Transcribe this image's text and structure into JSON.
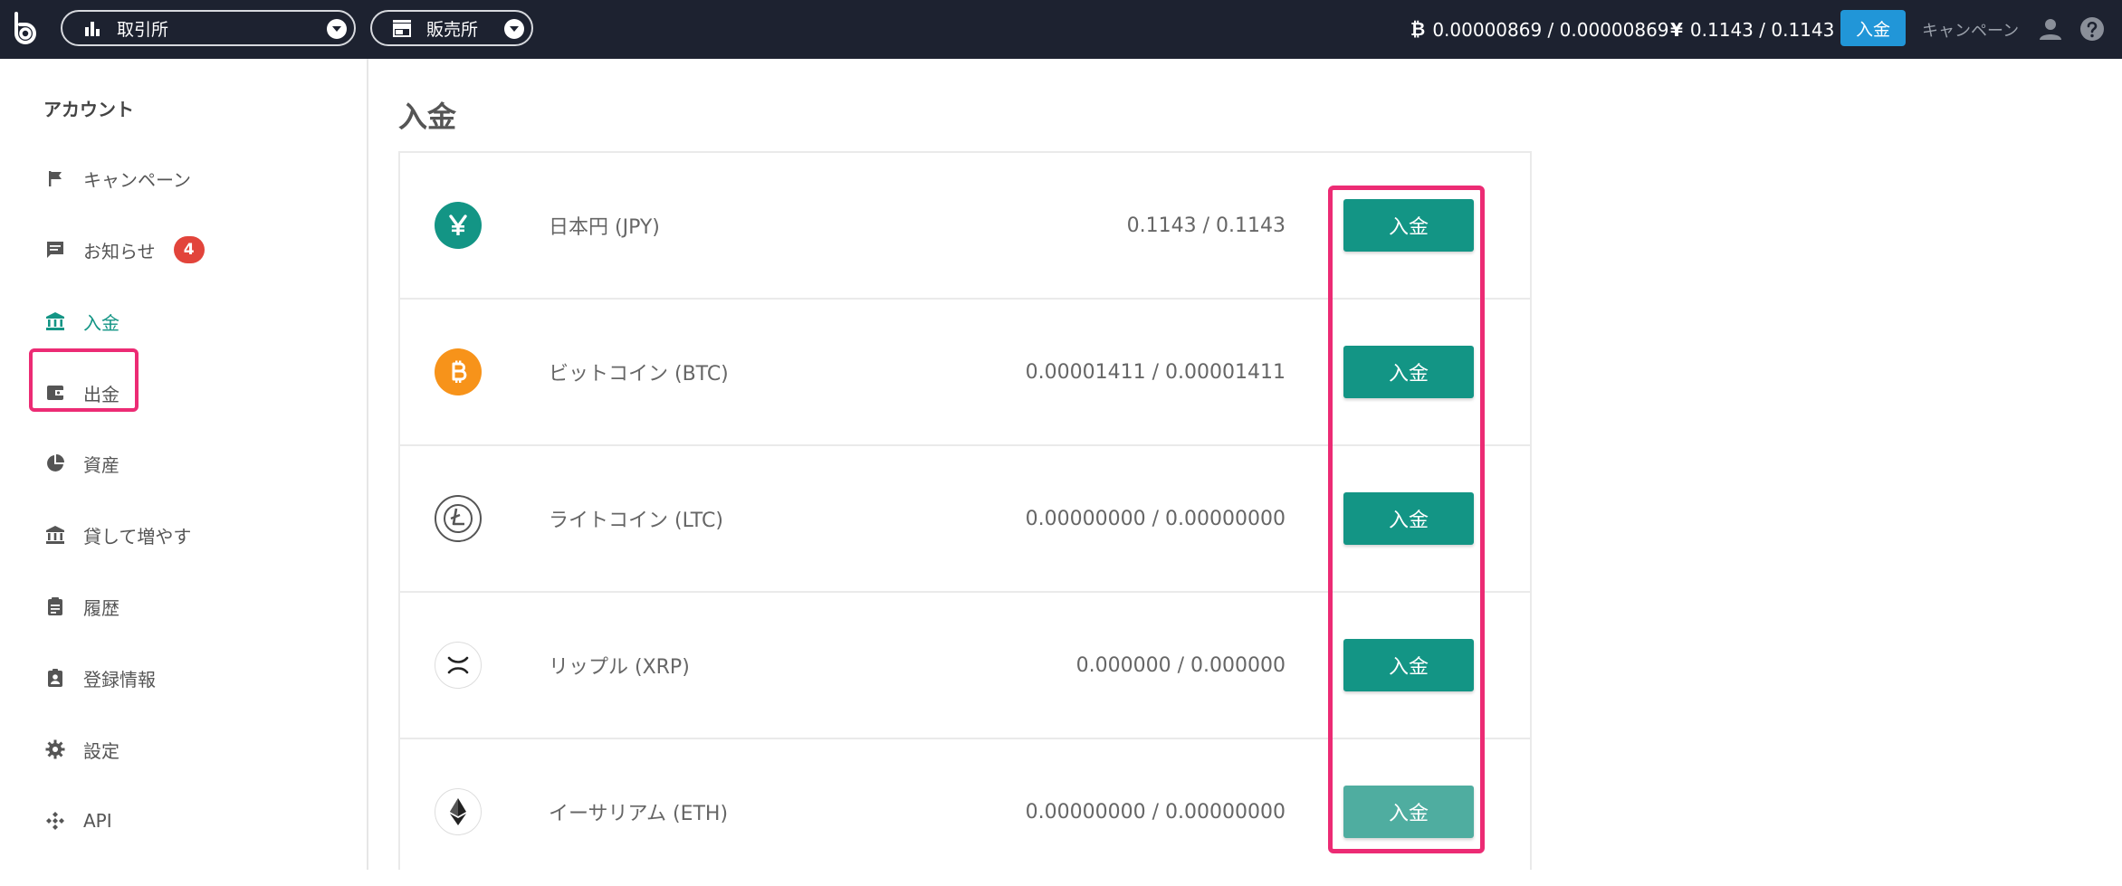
{
  "topbar": {
    "exchange_label": "取引所",
    "shop_label": "販売所",
    "btc_symbol": "₿",
    "btc_balance": "0.00000869 / 0.00000869",
    "jpy_symbol": "¥",
    "jpy_balance": "0.1143 / 0.1143",
    "deposit_label": "入金",
    "campaign_label": "キャンペーン"
  },
  "sidebar": {
    "heading": "アカウント",
    "items": [
      {
        "label": "キャンペーン",
        "icon": "flag-icon"
      },
      {
        "label": "お知らせ",
        "icon": "message-icon",
        "badge": "4"
      },
      {
        "label": "入金",
        "icon": "bank-icon",
        "active": true
      },
      {
        "label": "出金",
        "icon": "wallet-icon"
      },
      {
        "label": "資産",
        "icon": "pie-chart-icon"
      },
      {
        "label": "貸して増やす",
        "icon": "bank-icon"
      },
      {
        "label": "履歴",
        "icon": "clipboard-icon"
      },
      {
        "label": "登録情報",
        "icon": "badge-icon"
      },
      {
        "label": "設定",
        "icon": "gear-icon"
      },
      {
        "label": "API",
        "icon": "api-icon"
      }
    ]
  },
  "main": {
    "title": "入金",
    "rows": [
      {
        "name": "日本円 (JPY)",
        "balance": "0.1143 / 0.1143",
        "button": "入金",
        "icon": "yen-icon",
        "color": "#139585"
      },
      {
        "name": "ビットコイン (BTC)",
        "balance": "0.00001411 / 0.00001411",
        "button": "入金",
        "icon": "bitcoin-icon",
        "color": "#f7931a"
      },
      {
        "name": "ライトコイン (LTC)",
        "balance": "0.00000000 / 0.00000000",
        "button": "入金",
        "icon": "litecoin-icon",
        "color": "#ffffff"
      },
      {
        "name": "リップル (XRP)",
        "balance": "0.000000 / 0.000000",
        "button": "入金",
        "icon": "ripple-icon",
        "color": "#ffffff"
      },
      {
        "name": "イーサリアム (ETH)",
        "balance": "0.00000000 / 0.00000000",
        "button": "入金",
        "icon": "ethereum-icon",
        "color": "#ffffff"
      }
    ]
  },
  "colors": {
    "topbar_bg": "#1d2230",
    "accent_teal": "#139585",
    "deposit_blue": "#2196d8",
    "highlight_pink": "#ec2b74",
    "badge_red": "#e2443b"
  }
}
